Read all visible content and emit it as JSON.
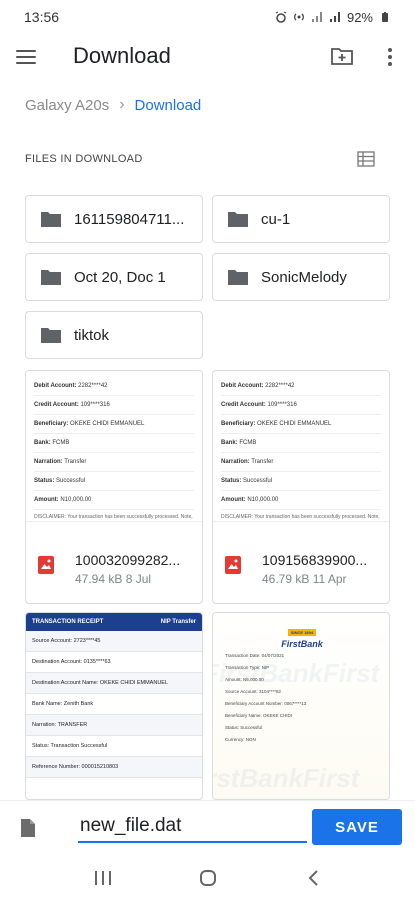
{
  "status_bar": {
    "time": "13:56",
    "battery": "92%",
    "icons": [
      "alarm-icon",
      "hotspot-icon",
      "signal-icon",
      "signal-icon",
      "battery-icon"
    ]
  },
  "app_bar": {
    "title": "Download",
    "icons": [
      "menu-icon",
      "new-folder-icon",
      "more-vert-icon"
    ]
  },
  "breadcrumb": {
    "root": "Galaxy A20s",
    "separator": "›",
    "current": "Download"
  },
  "section": {
    "header": "FILES IN DOWNLOAD",
    "view_icon": "list-view-icon"
  },
  "folders": [
    {
      "name": "161159804711..."
    },
    {
      "name": "cu-1"
    },
    {
      "name": "Oct 20, Doc 1"
    },
    {
      "name": "SonicMelody"
    },
    {
      "name": "tiktok"
    }
  ],
  "files": [
    {
      "name": "100032099282...",
      "meta": "47.94 kB 8 Jul",
      "icon": "pdf-icon"
    },
    {
      "name": "109156839900...",
      "meta": "46.79 kB 11 Apr",
      "icon": "pdf-icon"
    }
  ],
  "thumb_doc": {
    "rows": [
      {
        "label": "Debit Account:",
        "value": "2282****42"
      },
      {
        "label": "Credit Account:",
        "value": "109****316"
      },
      {
        "label": "Beneficiary:",
        "value": "OKEKE CHIDI EMMANUEL"
      },
      {
        "label": "Bank:",
        "value": "FCMB"
      },
      {
        "label": "Narration:",
        "value": "Transfer"
      },
      {
        "label": "Status:",
        "value": "Successful"
      },
      {
        "label": "Amount:",
        "value": "N10,000.00"
      }
    ],
    "disclaimer": "DISCLAIMER: Your transaction has been successfully processed. Note, however, that completion of any transfer may be affected by other factors including but not limited to..."
  },
  "thumb_receipt": {
    "header_left": "TRANSACTION RECEIPT",
    "header_right": "NIP Transfer",
    "rows": [
      "Source Account: 2723****45",
      "Destination Account: 0135****63",
      "Destination Account Name: OKEKE CHIDI EMMANUEL",
      "Bank Name: Zenith Bank",
      "Narration: TRANSFER",
      "Status: Transaction Successful",
      "Reference Number: 000015210803"
    ]
  },
  "thumb_firstbank": {
    "tag": "SINCE 1894",
    "brand": "FirstBank",
    "rows": [
      "Transaction Date: 04/07/2021",
      "Transaction Type: NIP",
      "Amount: N5,000.00",
      "Source Account: 3104****82",
      "Beneficiary Account Number: 0067****13",
      "Beneficiary Name: OKEKE CHIDI",
      "Status: Successful",
      "Currency: NGN"
    ],
    "watermark": "FirstBankFirst"
  },
  "save_bar": {
    "filename": "new_file.dat",
    "save_label": "SAVE",
    "icon": "document-icon"
  },
  "nav_bar": {
    "icons": [
      "recents-icon",
      "home-icon",
      "back-icon"
    ]
  },
  "colors": {
    "accent": "#1a73e8",
    "folder_icon": "#5f6368",
    "pdf_red": "#e53935"
  }
}
